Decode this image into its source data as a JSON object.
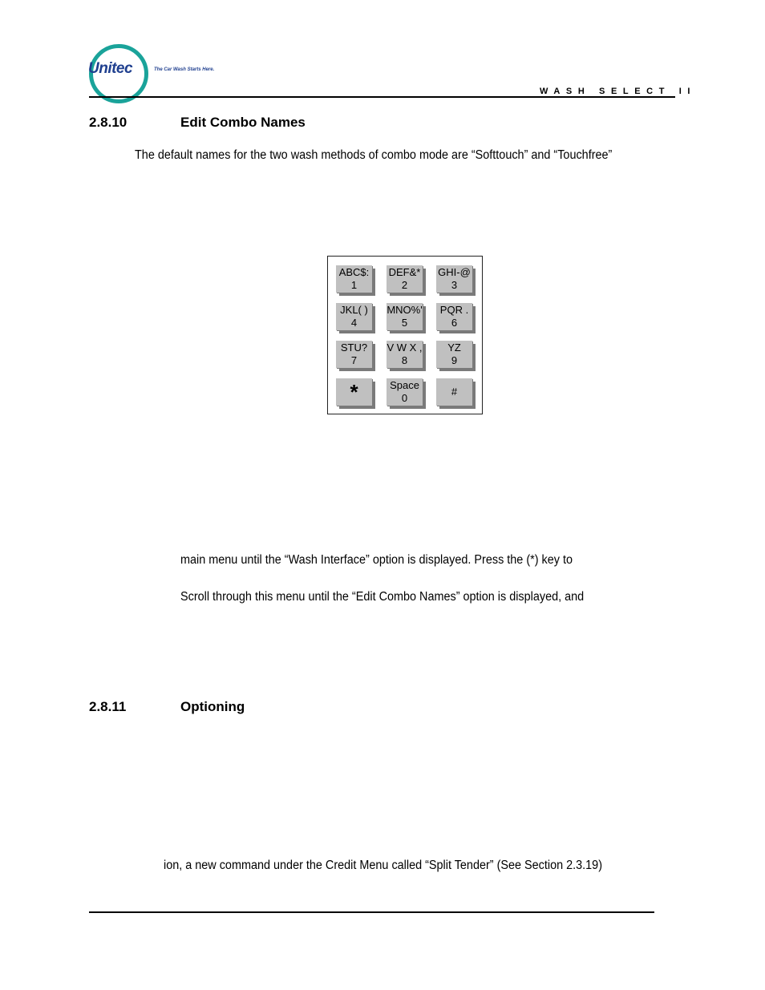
{
  "header": {
    "logo_text": "Unitec",
    "tagline": "The Car Wash Starts Here.",
    "running_title": "WASH SELECT II"
  },
  "sections": [
    {
      "number": "2.8.10",
      "title": "Edit Combo Names",
      "paragraph": "The default names for the two wash methods of combo mode are “Softtouch” and “Touchfree”"
    },
    {
      "number": "2.8.11",
      "title": "Optioning"
    }
  ],
  "keypad": {
    "keys": [
      {
        "top": "ABC$:",
        "bottom": "1"
      },
      {
        "top": "DEF&*",
        "bottom": "2"
      },
      {
        "top": "GHI-@",
        "bottom": "3"
      },
      {
        "top": "JKL( )",
        "bottom": "4"
      },
      {
        "top": "MNO%'",
        "bottom": "5"
      },
      {
        "top": "PQR .",
        "bottom": "6"
      },
      {
        "top": "STU?",
        "bottom": "7"
      },
      {
        "top": "V W X ,",
        "bottom": "8"
      },
      {
        "top": "YZ",
        "bottom": "9"
      },
      {
        "top": "*",
        "bottom": ""
      },
      {
        "top": "Space",
        "bottom": "0"
      },
      {
        "top": "#",
        "bottom": ""
      }
    ]
  },
  "fragments": {
    "line1": "main menu until the “Wash Interface” option is displayed. Press the (*) key to",
    "line2": "Scroll through this menu until the “Edit Combo Names” option is displayed, and",
    "line3": "ion, a new command under the Credit Menu called “Split Tender” (See Section 2.3.19)"
  },
  "colors": {
    "logo_ring": "#1aa39a",
    "logo_text": "#1f3f8f",
    "key_face": "#c0c0c0",
    "key_shadow": "#7a7a7a"
  }
}
